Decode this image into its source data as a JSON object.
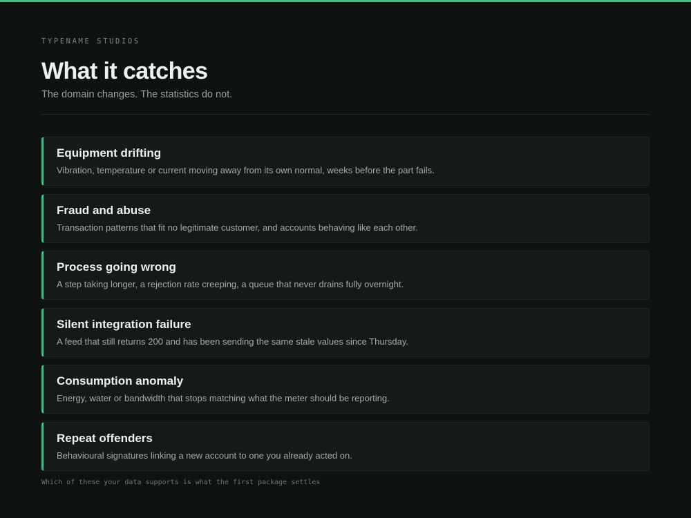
{
  "colors": {
    "background": "#0e1211",
    "accent": "#4fb886",
    "card_background": "#141a18",
    "title_text": "#eef1ef",
    "muted_text": "#9aa29f"
  },
  "header": {
    "eyebrow": "TYPENAME STUDIOS",
    "title": "What it catches",
    "subtitle": "The domain changes. The statistics do not."
  },
  "cards": [
    {
      "title": "Equipment drifting",
      "description": "Vibration, temperature or current moving away from its own normal, weeks before the part fails."
    },
    {
      "title": "Fraud and abuse",
      "description": "Transaction patterns that fit no legitimate customer, and accounts behaving like each other."
    },
    {
      "title": "Process going wrong",
      "description": "A step taking longer, a rejection rate creeping, a queue that never drains fully overnight."
    },
    {
      "title": "Silent integration failure",
      "description": "A feed that still returns 200 and has been sending the same stale values since Thursday."
    },
    {
      "title": "Consumption anomaly",
      "description": "Energy, water or bandwidth that stops matching what the meter should be reporting."
    },
    {
      "title": "Repeat offenders",
      "description": "Behavioural signatures linking a new account to one you already acted on."
    }
  ],
  "footnote": "Which of these your data supports is what the first package settles"
}
